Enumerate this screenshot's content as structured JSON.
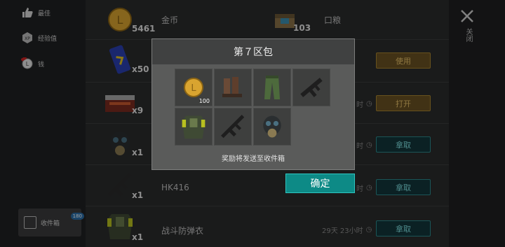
{
  "sidebar": {
    "items": [
      {
        "label": "最佳",
        "icon": "thumbs-up-icon"
      },
      {
        "label": "经验值",
        "icon": "xp-icon"
      },
      {
        "label": "钱",
        "icon": "coin-icon"
      }
    ],
    "mailbox": {
      "label": "收件箱",
      "badge": "180",
      "icon": "mailbox-icon"
    }
  },
  "close": {
    "label": "关闭"
  },
  "rows": [
    {
      "qty": "5461",
      "name": "金币",
      "icon": "gold-coin-icon",
      "qty2": "103",
      "name2": "口粮",
      "icon2": "ration-box-icon"
    },
    {
      "qty": "x50",
      "name": "",
      "icon": "energy-drink-icon",
      "button": "使用"
    },
    {
      "qty": "x9",
      "name": "",
      "icon": "supply-crate-icon",
      "timer": "时",
      "button": "打开"
    },
    {
      "qty": "x1",
      "name": "",
      "icon": "gas-mask-icon",
      "timer": "时",
      "button": "拿取"
    },
    {
      "qty": "x1",
      "name": "HK416",
      "icon": "rifle-icon",
      "timer": "时",
      "button": "拿取"
    },
    {
      "qty": "x1",
      "name": "战斗防弹衣",
      "icon": "body-armor-icon",
      "timer": "29天 23小时",
      "button": "拿取"
    }
  ],
  "modal": {
    "title": "第７区包",
    "items": [
      {
        "icon": "gold-coin-icon",
        "count": "100"
      },
      {
        "icon": "boots-icon",
        "count": ""
      },
      {
        "icon": "pants-icon",
        "count": ""
      },
      {
        "icon": "smg-icon",
        "count": ""
      },
      {
        "icon": "body-armor-icon",
        "count": ""
      },
      {
        "icon": "assault-rifle-icon",
        "count": ""
      },
      {
        "icon": "gas-mask-icon",
        "count": ""
      }
    ],
    "note": "奖励将发送至收件箱",
    "confirm": "确定"
  },
  "colors": {
    "teal": "#0d8a86",
    "gold": "#a6832f",
    "modal_bg": "#5a5b5a"
  }
}
